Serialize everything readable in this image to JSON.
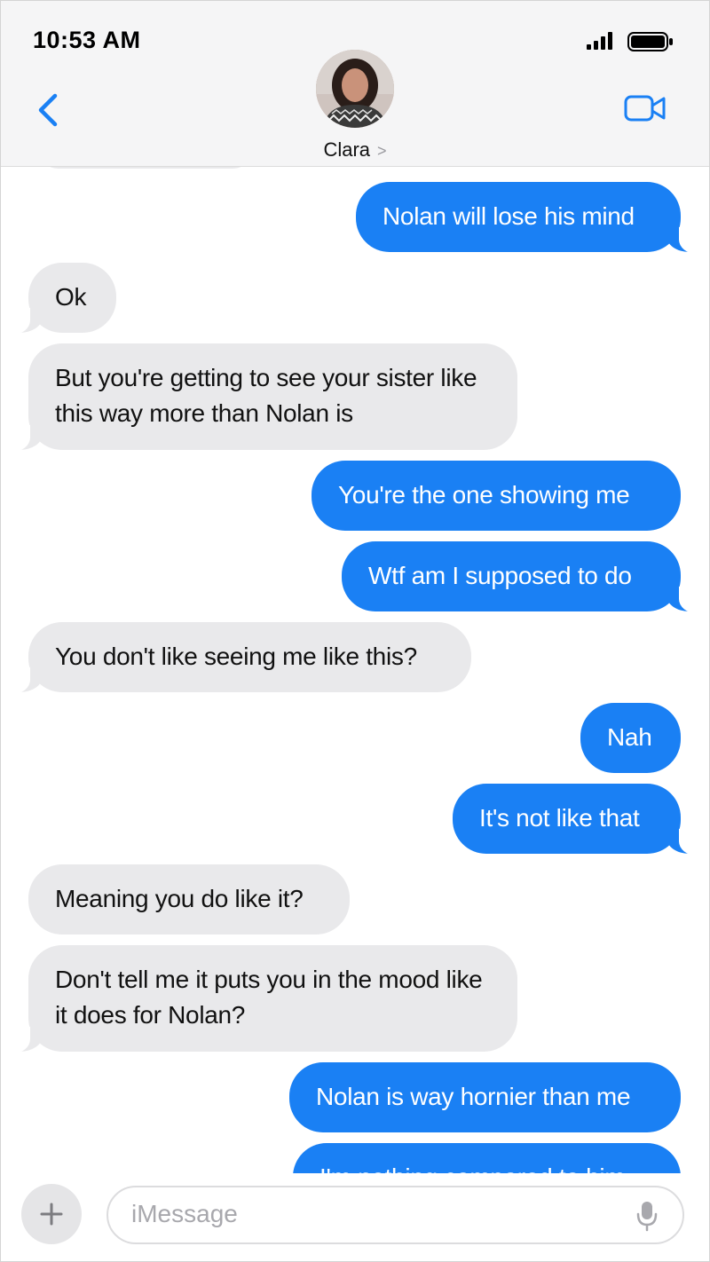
{
  "status_bar": {
    "time": "10:53 AM"
  },
  "header": {
    "contact_name": "Clara",
    "contact_chevron": ">"
  },
  "messages": [
    {
      "from": "me",
      "text": "Nolan will lose his mind"
    },
    {
      "from": "them",
      "text": "Ok"
    },
    {
      "from": "them",
      "text": "But you're getting to see your sister like this way more than Nolan is"
    },
    {
      "from": "me",
      "text": "You're the one showing me"
    },
    {
      "from": "me",
      "text": "Wtf am I supposed to do"
    },
    {
      "from": "them",
      "text": "You don't like seeing me like this?"
    },
    {
      "from": "me",
      "text": "Nah"
    },
    {
      "from": "me",
      "text": "It's not like that"
    },
    {
      "from": "them",
      "text": "Meaning you do like it?"
    },
    {
      "from": "them",
      "text": "Don't tell me it puts you in the mood like it does for Nolan?"
    },
    {
      "from": "me",
      "text": "Nolan is way hornier than me"
    },
    {
      "from": "me",
      "text": "I'm nothing compared to him"
    }
  ],
  "compose": {
    "placeholder": "iMessage"
  },
  "colors": {
    "sent_bubble": "#1a80f4",
    "received_bubble": "#e9e9eb",
    "accent": "#1a80f4"
  },
  "icons": [
    "signal-icon",
    "battery-icon",
    "back-chevron-icon",
    "video-call-icon",
    "plus-icon",
    "microphone-icon"
  ]
}
